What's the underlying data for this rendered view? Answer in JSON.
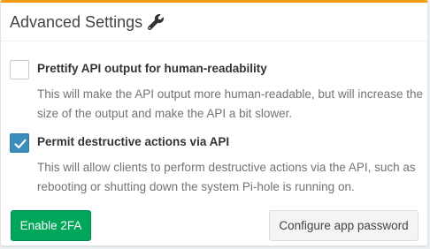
{
  "panel": {
    "title": "Advanced Settings",
    "title_icon": "wrench-icon",
    "accent_color": "#f39c12"
  },
  "options": [
    {
      "label": "Prettify API output for human-readability",
      "help": "This will make the API output more human-readable, but will increase the size of the output and make the API a bit slower.",
      "checked": false
    },
    {
      "label": "Permit destructive actions via API",
      "help": "This will allow clients to perform destructive actions via the API, such as rebooting or shutting down the system Pi-hole is running on.",
      "checked": true
    }
  ],
  "buttons": {
    "enable_2fa": "Enable 2FA",
    "configure_app_password": "Configure app password"
  },
  "colors": {
    "checkbox_checked": "#3c8dbc",
    "success_button": "#00a65a",
    "default_button": "#f4f4f4"
  }
}
